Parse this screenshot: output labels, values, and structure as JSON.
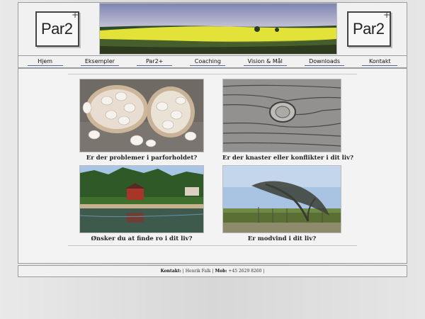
{
  "logo": {
    "text": "Par2",
    "sup": "+"
  },
  "nav": [
    {
      "label": "Hjem"
    },
    {
      "label": "Eksempler"
    },
    {
      "label": "Par2+"
    },
    {
      "label": "Coaching"
    },
    {
      "label": "Vision & Mål"
    },
    {
      "label": "Downloads"
    },
    {
      "label": "Kontakt"
    }
  ],
  "cards": [
    {
      "caption": "Er der problemer i parforholdet?"
    },
    {
      "caption": "Er der knaster eller konflikter i dit liv?"
    },
    {
      "caption": "Ønsker du at finde ro i dit liv?"
    },
    {
      "caption": "Er modvind i dit liv?"
    }
  ],
  "footer": {
    "label": "Kontakt:",
    "name": "Henrik Falk",
    "mob_label": "Mob:",
    "mob": "+45 2629 8260"
  }
}
